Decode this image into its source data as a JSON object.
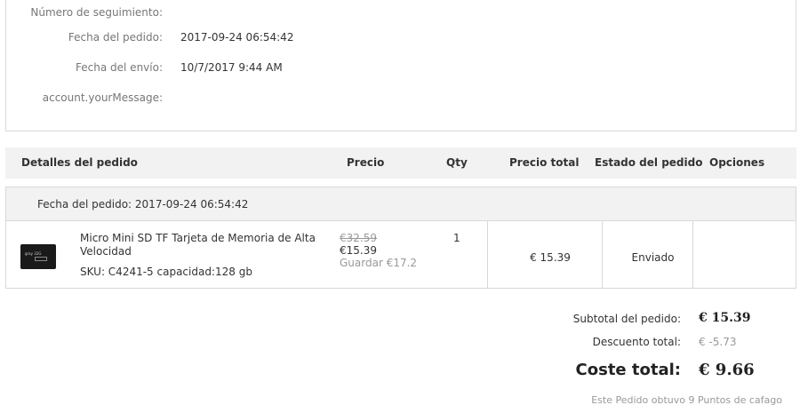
{
  "order_info": {
    "tracking_label": "Número de seguimiento:",
    "tracking_value": "",
    "order_date_label": "Fecha del pedido:",
    "order_date_value": "2017-09-24 06:54:42",
    "ship_date_label": "Fecha del envío:",
    "ship_date_value": "10/7/2017 9:44 AM",
    "message_label": "account.yourMessage:",
    "message_value": ""
  },
  "table": {
    "headers": {
      "details": "Detalles del pedido",
      "price": "Precio",
      "qty": "Qty",
      "total": "Precio total",
      "status": "Estado del pedido",
      "options": "Opciones"
    },
    "order_date_bar": "Fecha del pedido: 2017-09-24 06:54:42",
    "item": {
      "title": "Micro Mini SD TF Tarjeta de Memoria de Alta Velocidad",
      "sku": "SKU: C4241-5   capacidad:128 gb",
      "price_old": "€32.59",
      "price_new": "€15.39",
      "price_save": "Guardar €17.2",
      "qty": "1",
      "total": "€ 15.39",
      "status": "Enviado",
      "thumbnail_icon": "sd-card-image",
      "thumbnail_brand": "gray 32G",
      "thumbnail_capacity": "128m"
    }
  },
  "summary": {
    "subtotal_label": "Subtotal del pedido:",
    "subtotal_value": "€ 15.39",
    "discount_label": "Descuento total:",
    "discount_value": "€ -5.73",
    "grand_label": "Coste total:",
    "grand_value": "€ 9.66",
    "points_note": "Este Pedido obtuvo  9 Puntos de cafago"
  }
}
